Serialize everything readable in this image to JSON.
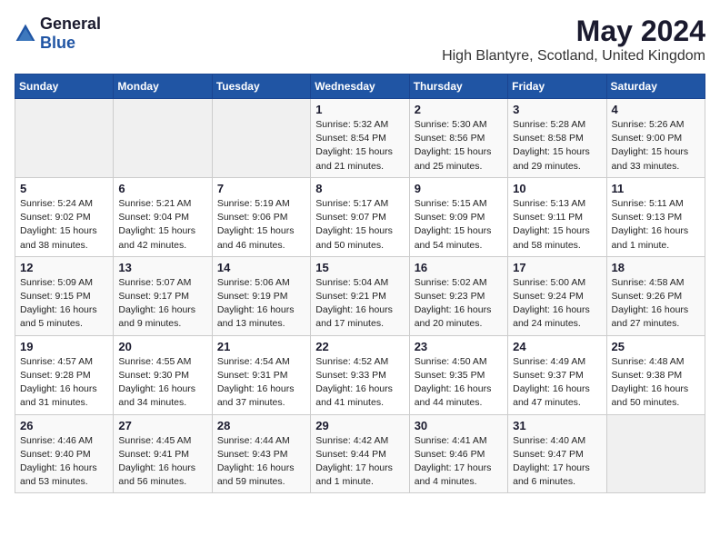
{
  "header": {
    "logo_general": "General",
    "logo_blue": "Blue",
    "title": "May 2024",
    "subtitle": "High Blantyre, Scotland, United Kingdom"
  },
  "weekdays": [
    "Sunday",
    "Monday",
    "Tuesday",
    "Wednesday",
    "Thursday",
    "Friday",
    "Saturday"
  ],
  "weeks": [
    [
      {
        "day": "",
        "info": ""
      },
      {
        "day": "",
        "info": ""
      },
      {
        "day": "",
        "info": ""
      },
      {
        "day": "1",
        "info": "Sunrise: 5:32 AM\nSunset: 8:54 PM\nDaylight: 15 hours\nand 21 minutes."
      },
      {
        "day": "2",
        "info": "Sunrise: 5:30 AM\nSunset: 8:56 PM\nDaylight: 15 hours\nand 25 minutes."
      },
      {
        "day": "3",
        "info": "Sunrise: 5:28 AM\nSunset: 8:58 PM\nDaylight: 15 hours\nand 29 minutes."
      },
      {
        "day": "4",
        "info": "Sunrise: 5:26 AM\nSunset: 9:00 PM\nDaylight: 15 hours\nand 33 minutes."
      }
    ],
    [
      {
        "day": "5",
        "info": "Sunrise: 5:24 AM\nSunset: 9:02 PM\nDaylight: 15 hours\nand 38 minutes."
      },
      {
        "day": "6",
        "info": "Sunrise: 5:21 AM\nSunset: 9:04 PM\nDaylight: 15 hours\nand 42 minutes."
      },
      {
        "day": "7",
        "info": "Sunrise: 5:19 AM\nSunset: 9:06 PM\nDaylight: 15 hours\nand 46 minutes."
      },
      {
        "day": "8",
        "info": "Sunrise: 5:17 AM\nSunset: 9:07 PM\nDaylight: 15 hours\nand 50 minutes."
      },
      {
        "day": "9",
        "info": "Sunrise: 5:15 AM\nSunset: 9:09 PM\nDaylight: 15 hours\nand 54 minutes."
      },
      {
        "day": "10",
        "info": "Sunrise: 5:13 AM\nSunset: 9:11 PM\nDaylight: 15 hours\nand 58 minutes."
      },
      {
        "day": "11",
        "info": "Sunrise: 5:11 AM\nSunset: 9:13 PM\nDaylight: 16 hours\nand 1 minute."
      }
    ],
    [
      {
        "day": "12",
        "info": "Sunrise: 5:09 AM\nSunset: 9:15 PM\nDaylight: 16 hours\nand 5 minutes."
      },
      {
        "day": "13",
        "info": "Sunrise: 5:07 AM\nSunset: 9:17 PM\nDaylight: 16 hours\nand 9 minutes."
      },
      {
        "day": "14",
        "info": "Sunrise: 5:06 AM\nSunset: 9:19 PM\nDaylight: 16 hours\nand 13 minutes."
      },
      {
        "day": "15",
        "info": "Sunrise: 5:04 AM\nSunset: 9:21 PM\nDaylight: 16 hours\nand 17 minutes."
      },
      {
        "day": "16",
        "info": "Sunrise: 5:02 AM\nSunset: 9:23 PM\nDaylight: 16 hours\nand 20 minutes."
      },
      {
        "day": "17",
        "info": "Sunrise: 5:00 AM\nSunset: 9:24 PM\nDaylight: 16 hours\nand 24 minutes."
      },
      {
        "day": "18",
        "info": "Sunrise: 4:58 AM\nSunset: 9:26 PM\nDaylight: 16 hours\nand 27 minutes."
      }
    ],
    [
      {
        "day": "19",
        "info": "Sunrise: 4:57 AM\nSunset: 9:28 PM\nDaylight: 16 hours\nand 31 minutes."
      },
      {
        "day": "20",
        "info": "Sunrise: 4:55 AM\nSunset: 9:30 PM\nDaylight: 16 hours\nand 34 minutes."
      },
      {
        "day": "21",
        "info": "Sunrise: 4:54 AM\nSunset: 9:31 PM\nDaylight: 16 hours\nand 37 minutes."
      },
      {
        "day": "22",
        "info": "Sunrise: 4:52 AM\nSunset: 9:33 PM\nDaylight: 16 hours\nand 41 minutes."
      },
      {
        "day": "23",
        "info": "Sunrise: 4:50 AM\nSunset: 9:35 PM\nDaylight: 16 hours\nand 44 minutes."
      },
      {
        "day": "24",
        "info": "Sunrise: 4:49 AM\nSunset: 9:37 PM\nDaylight: 16 hours\nand 47 minutes."
      },
      {
        "day": "25",
        "info": "Sunrise: 4:48 AM\nSunset: 9:38 PM\nDaylight: 16 hours\nand 50 minutes."
      }
    ],
    [
      {
        "day": "26",
        "info": "Sunrise: 4:46 AM\nSunset: 9:40 PM\nDaylight: 16 hours\nand 53 minutes."
      },
      {
        "day": "27",
        "info": "Sunrise: 4:45 AM\nSunset: 9:41 PM\nDaylight: 16 hours\nand 56 minutes."
      },
      {
        "day": "28",
        "info": "Sunrise: 4:44 AM\nSunset: 9:43 PM\nDaylight: 16 hours\nand 59 minutes."
      },
      {
        "day": "29",
        "info": "Sunrise: 4:42 AM\nSunset: 9:44 PM\nDaylight: 17 hours\nand 1 minute."
      },
      {
        "day": "30",
        "info": "Sunrise: 4:41 AM\nSunset: 9:46 PM\nDaylight: 17 hours\nand 4 minutes."
      },
      {
        "day": "31",
        "info": "Sunrise: 4:40 AM\nSunset: 9:47 PM\nDaylight: 17 hours\nand 6 minutes."
      },
      {
        "day": "",
        "info": ""
      }
    ]
  ]
}
